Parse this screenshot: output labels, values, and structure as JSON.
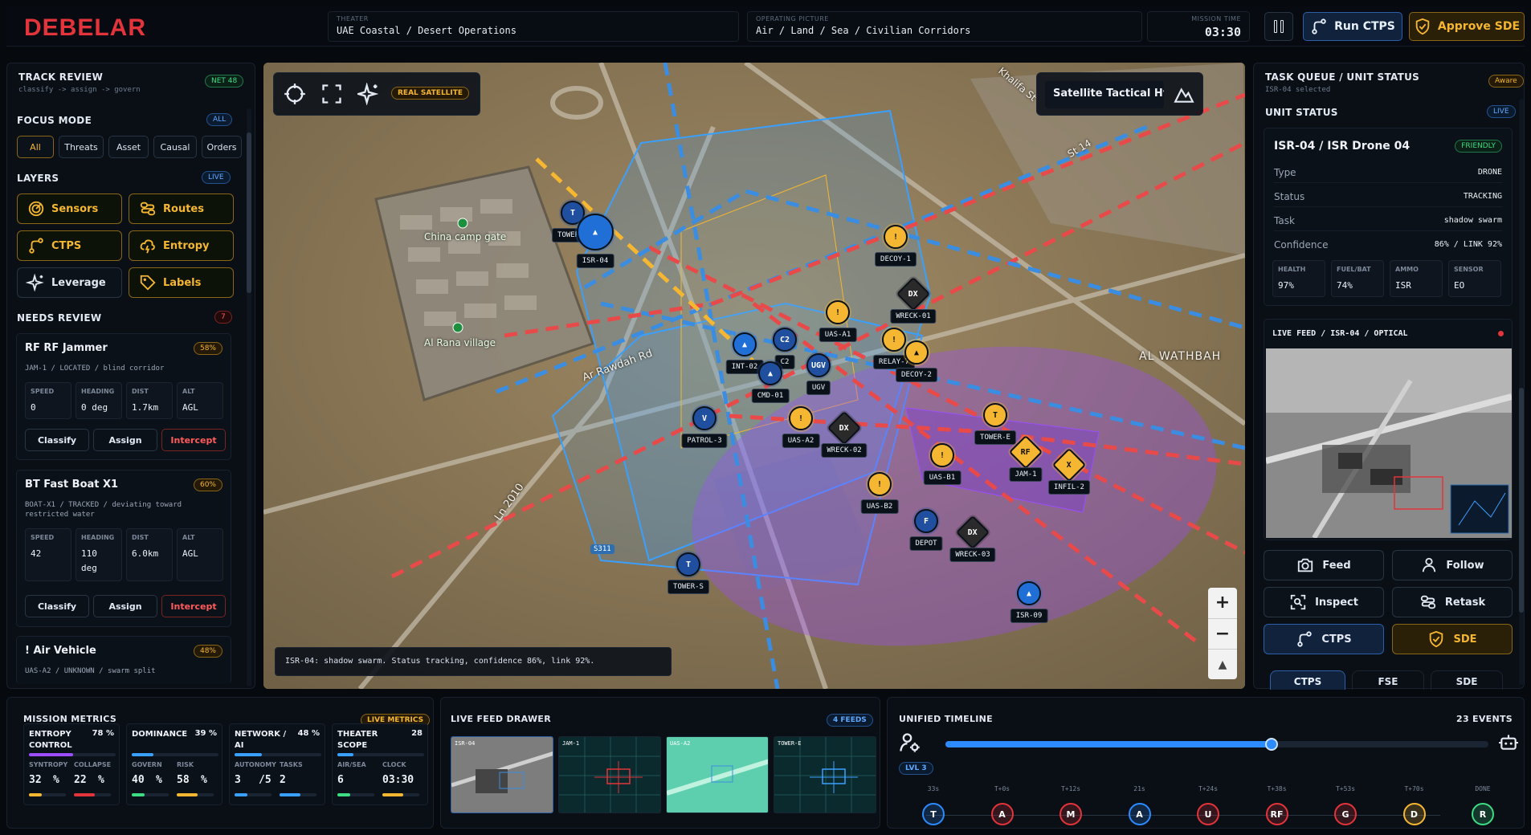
{
  "app": {
    "logo": "DEBELAR"
  },
  "header": {
    "theater_label": "THEATER",
    "theater_value": "UAE Coastal / Desert Operations",
    "picture_label": "OPERATING PICTURE",
    "picture_value": "Air / Land / Sea / Civilian Corridors",
    "time_label": "MISSION TIME",
    "time_value": "03:30",
    "run_label": "Run CTPS",
    "approve_label": "Approve SDE"
  },
  "left": {
    "title": "TRACK REVIEW",
    "subtitle": "classify -> assign -> govern",
    "net_badge": "NET 48",
    "focus_title": "FOCUS MODE",
    "focus_badge": "ALL",
    "focus_chips": [
      "All",
      "Threats",
      "Asset",
      "Causal",
      "Orders"
    ],
    "layers_title": "LAYERS",
    "layers_badge": "LIVE",
    "layers": [
      "Sensors",
      "Routes",
      "CTPS",
      "Entropy",
      "Leverage",
      "Labels"
    ],
    "review_title": "NEEDS REVIEW",
    "review_count": "7",
    "cards": [
      {
        "title": "RF RF Jammer",
        "pct": "58%",
        "sub": "JAM-1 / LOCATED / blind corridor",
        "stats": [
          {
            "k": "SPEED",
            "v": "0"
          },
          {
            "k": "HEADING",
            "v": "0 deg"
          },
          {
            "k": "DIST",
            "v": "1.7km"
          },
          {
            "k": "ALT",
            "v": "AGL"
          }
        ]
      },
      {
        "title": "BT Fast Boat X1",
        "pct": "60%",
        "sub": "BOAT-X1 / TRACKED / deviating toward",
        "sub2": "restricted water",
        "stats": [
          {
            "k": "SPEED",
            "v": "42"
          },
          {
            "k": "HEADING",
            "v": "110"
          },
          {
            "k": "DIST",
            "v": "6.0km"
          },
          {
            "k": "ALT",
            "v": "AGL"
          }
        ],
        "heading_unit": "deg"
      },
      {
        "title": "! Air Vehicle",
        "pct": "48%",
        "sub": "UAS-A2 / UNKNOWN / swarm split"
      }
    ],
    "actions": [
      "Classify",
      "Assign",
      "Intercept"
    ]
  },
  "map": {
    "mode_badge": "REAL SATELLITE",
    "basemap": "Satellite Tactical Hybrid",
    "status_line": "ISR-04: shadow swarm. Status tracking, confidence 86%, link 92%.",
    "places": [
      "China camp gate",
      "Al Rana village",
      "Ar Rawdah Rd",
      "Ln 2010",
      "AL WATHBAH",
      "Khalifa St",
      "St 14"
    ],
    "road_tag": "S311",
    "markers": [
      "TOWER-N",
      "ISR-04",
      "DECOY-1",
      "WRECK-01",
      "RELAY-7",
      "DECOY-2",
      "UAS-A1",
      "INT-02",
      "C2",
      "CMD-01",
      "UGV",
      "UAS-A2",
      "WRECK-02",
      "PATROL-3",
      "TOWER-E",
      "JAM-1",
      "INFIL-2",
      "UAS-B1",
      "UAS-B2",
      "DEPOT",
      "WRECK-03",
      "TOWER-S",
      "ISR-09"
    ],
    "marker_glyphs": [
      "T",
      "!",
      "DX",
      "V",
      "C2",
      "RF",
      "X",
      "F"
    ]
  },
  "right": {
    "title": "TASK QUEUE / UNIT STATUS",
    "subtitle": "ISR-04 selected",
    "aware_badge": "Aware",
    "unit_status_title": "UNIT STATUS",
    "unit_status_badge": "LIVE",
    "unit_name": "ISR-04 / ISR Drone 04",
    "unit_badge": "FRIENDLY",
    "rows": [
      {
        "k": "Type",
        "v": "DRONE"
      },
      {
        "k": "Status",
        "v": "TRACKING"
      },
      {
        "k": "Task",
        "v": "shadow swarm"
      },
      {
        "k": "Confidence",
        "v": "86% / LINK 92%"
      }
    ],
    "vitals": [
      {
        "k": "HEALTH",
        "v": "97%"
      },
      {
        "k": "FUEL/BAT",
        "v": "74%"
      },
      {
        "k": "AMMO",
        "v": "ISR"
      },
      {
        "k": "SENSOR",
        "v": "EO"
      }
    ],
    "feed_title": "LIVE FEED / ISR-04 / OPTICAL",
    "buttons": [
      "Feed",
      "Follow",
      "Inspect",
      "Retask",
      "CTPS",
      "SDE"
    ],
    "tabs": [
      "CTPS",
      "FSE",
      "SDE"
    ]
  },
  "bottom": {
    "metrics_title": "MISSION METRICS",
    "metrics_badge": "LIVE METRICS",
    "metrics": [
      {
        "name": "ENTROPY CONTROL",
        "pct": "78 %",
        "s1k": "SYNTROPY",
        "s1v": "32",
        "s1u": "%",
        "s2k": "COLLAPSE",
        "s2v": "22",
        "s2u": "%"
      },
      {
        "name": "DOMINANCE",
        "pct": "39 %",
        "s1k": "GOVERN",
        "s1v": "40",
        "s1u": "%",
        "s2k": "RISK",
        "s2v": "58",
        "s2u": "%"
      },
      {
        "name": "NETWORK / AI",
        "pct": "48 %",
        "s1k": "AUTONOMY",
        "s1v": "3",
        "s1u": "/5",
        "s2k": "TASKS",
        "s2v": "2",
        "s2u": ""
      },
      {
        "name": "THEATER SCOPE",
        "pct": "28",
        "s1k": "AIR/SEA",
        "s1v": "6",
        "s1u": "",
        "s2k": "CLOCK",
        "s2v": "03:30",
        "s2u": ""
      }
    ],
    "feed_title": "LIVE FEED DRAWER",
    "feed_badge": "4 FEEDS",
    "feeds": [
      "ISR-04",
      "JAM-1",
      "UAS-A2",
      "TOWER-E"
    ],
    "timeline_title": "UNIFIED TIMELINE",
    "timeline_count": "23 EVENTS",
    "level_badge": "LVL 3",
    "timeline_progress": 0.6,
    "timeline_labels": [
      "33s",
      "T+0s",
      "T+12s",
      "21s",
      "T+24s",
      "T+38s",
      "T+53s",
      "T+70s",
      "DONE"
    ],
    "timeline_nodes": [
      "T",
      "A",
      "M",
      "A",
      "U",
      "RF",
      "G",
      "D",
      "R"
    ]
  }
}
